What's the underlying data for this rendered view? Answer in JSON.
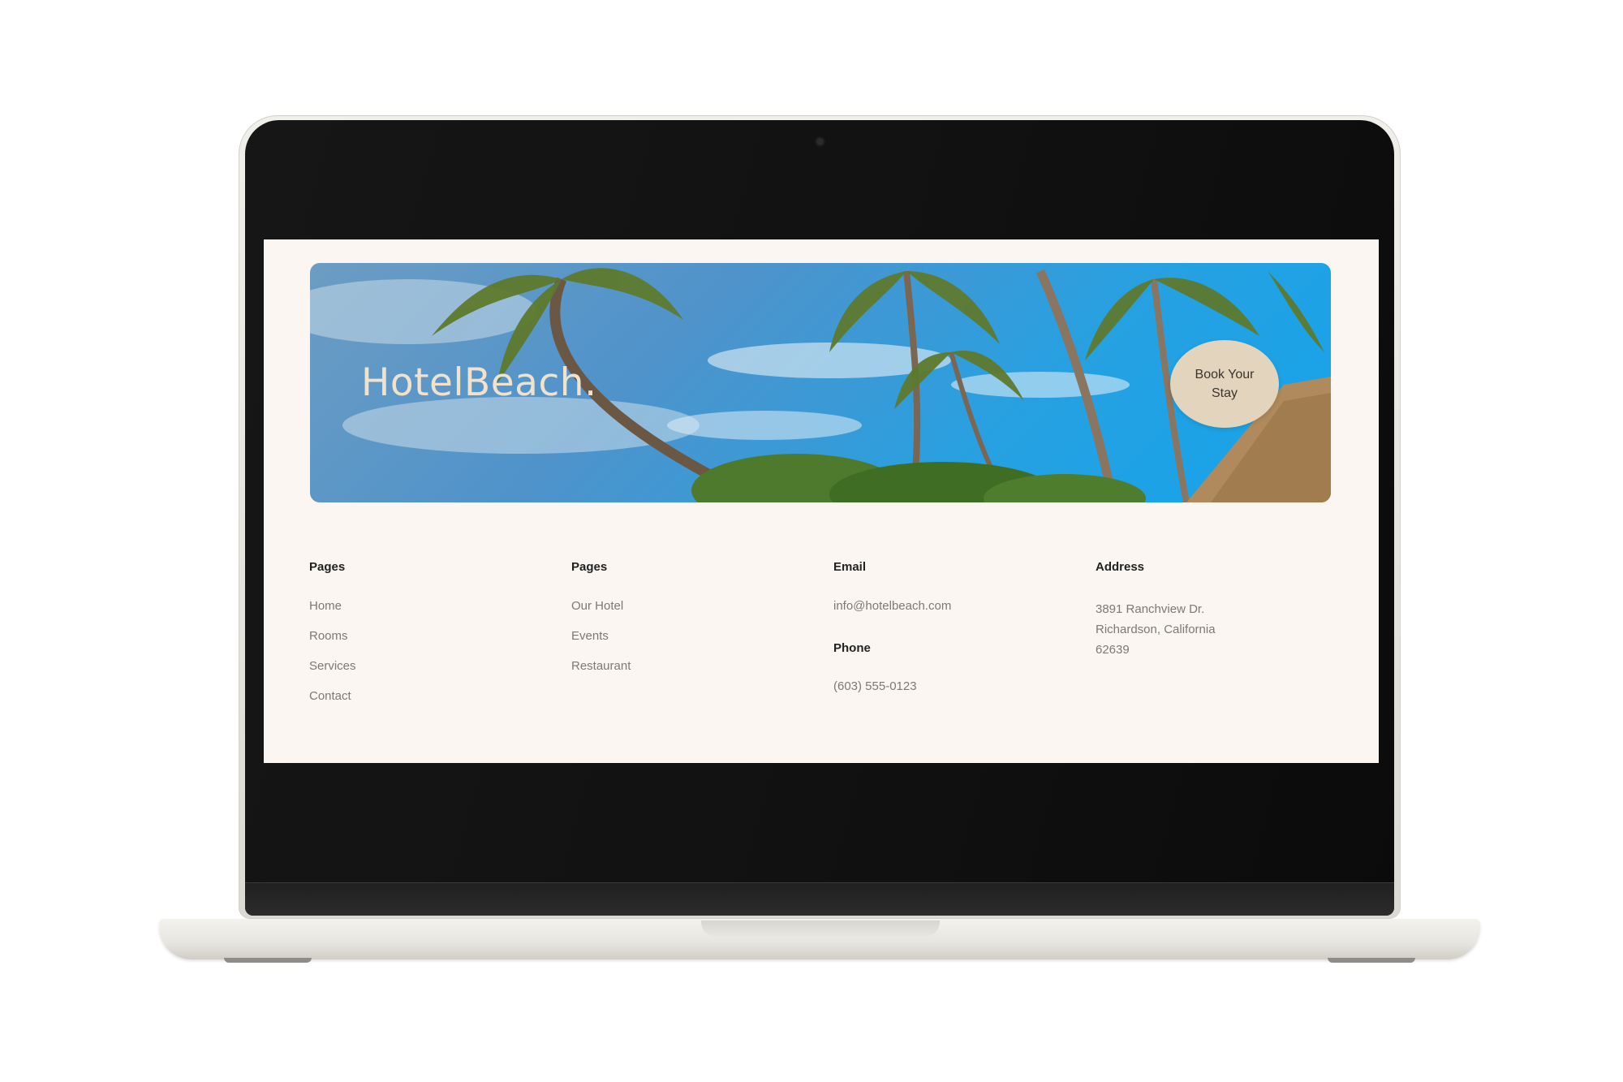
{
  "hero": {
    "title": "HotelBeach.",
    "cta_label": "Book Your Stay"
  },
  "footer": {
    "columns": [
      {
        "heading": "Pages",
        "links": [
          "Home",
          "Rooms",
          "Services",
          "Contact"
        ]
      },
      {
        "heading": "Pages",
        "links": [
          "Our Hotel",
          "Events",
          "Restaurant"
        ]
      }
    ],
    "email": {
      "heading": "Email",
      "value": "info@hotelbeach.com"
    },
    "phone": {
      "heading": "Phone",
      "value": "(603) 555-0123"
    },
    "address": {
      "heading": "Address",
      "lines": [
        "3891 Ranchview Dr.",
        "Richardson, California",
        "62639"
      ]
    }
  },
  "colors": {
    "page_background": "#fbf6f1",
    "cta_background": "#e3d5bd",
    "title_color": "#f0e2cc",
    "link_color": "#7d7873"
  }
}
